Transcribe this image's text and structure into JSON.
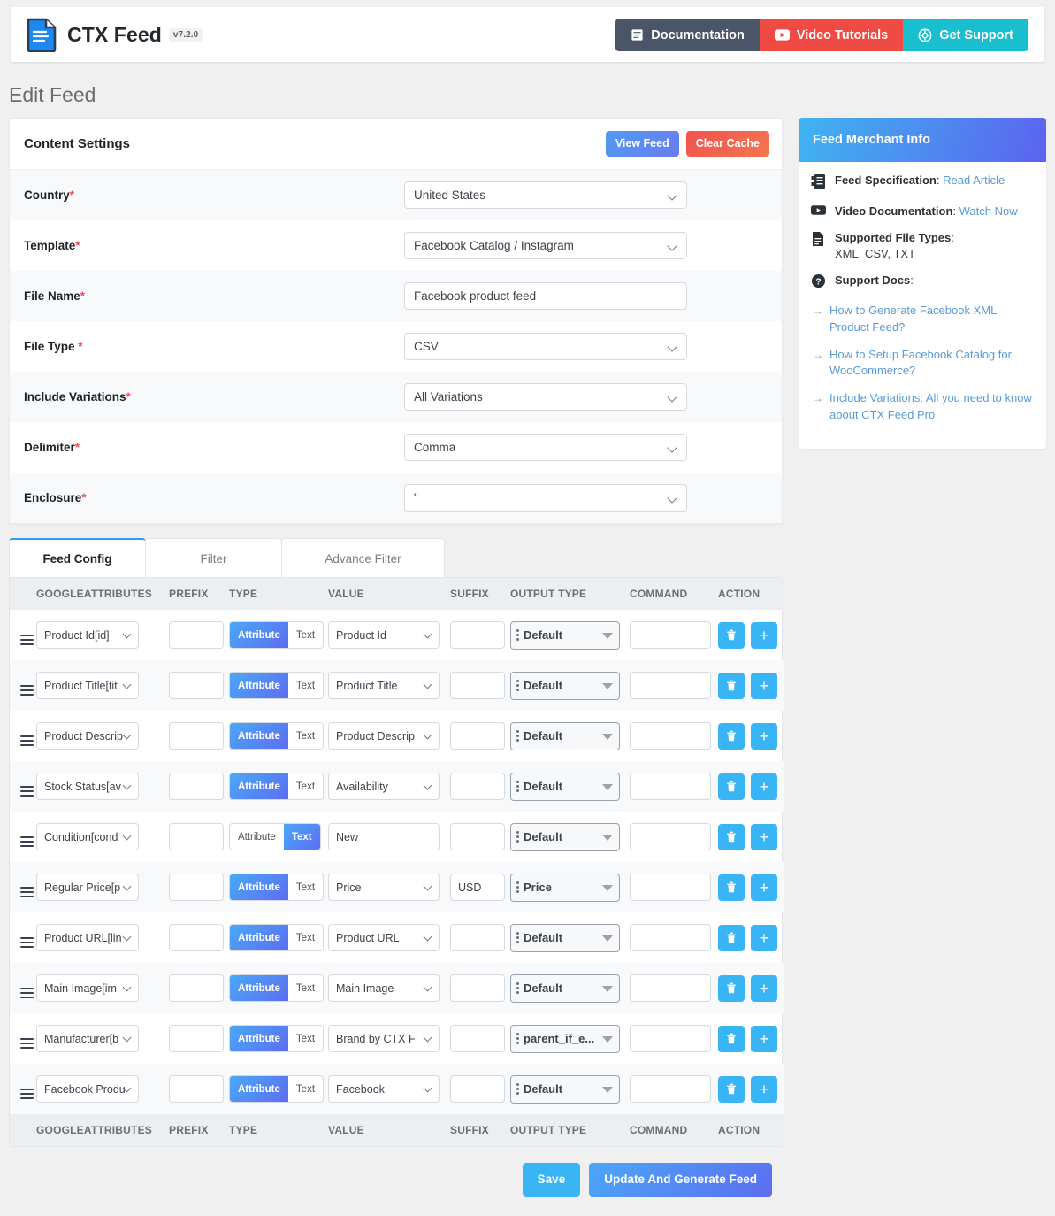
{
  "topbar": {
    "brand": "CTX Feed",
    "version": "v7.2.0",
    "logo_icon": "document-icon",
    "links": [
      {
        "label": "Documentation",
        "icon": "book-icon"
      },
      {
        "label": "Video Tutorials",
        "icon": "youtube-icon"
      },
      {
        "label": "Get Support",
        "icon": "lifebuoy-icon"
      }
    ]
  },
  "page": {
    "title": "Edit Feed"
  },
  "content_settings": {
    "heading": "Content Settings",
    "view_feed_label": "View Feed",
    "clear_cache_label": "Clear Cache",
    "fields": [
      {
        "label": "Country",
        "required": true,
        "control": "select",
        "value": "United States"
      },
      {
        "label": "Template",
        "required": true,
        "control": "select",
        "value": "Facebook Catalog / Instagram"
      },
      {
        "label": "File Name",
        "required": true,
        "control": "text",
        "value": "Facebook product feed"
      },
      {
        "label": "File Type ",
        "required": true,
        "control": "select",
        "value": "CSV"
      },
      {
        "label": "Include Variations",
        "required": true,
        "control": "select",
        "value": "All Variations"
      },
      {
        "label": "Delimiter",
        "required": true,
        "control": "select",
        "value": "Comma"
      },
      {
        "label": "Enclosure",
        "required": true,
        "control": "select",
        "value": "\""
      }
    ]
  },
  "tabs": [
    {
      "label": "Feed Config",
      "active": true
    },
    {
      "label": "Filter",
      "active": false
    },
    {
      "label": "Advance Filter",
      "active": false
    }
  ],
  "table": {
    "columns": [
      "GOOGLEATTRIBUTES",
      "PREFIX",
      "TYPE",
      "VALUE",
      "SUFFIX",
      "OUTPUT TYPE",
      "COMMAND",
      "ACTION"
    ],
    "type_options": {
      "attribute": "Attribute",
      "text": "Text"
    },
    "rows": [
      {
        "attribute": "Product Id[id]",
        "prefix": "",
        "type": "attribute",
        "value": "Product Id",
        "value_control": "select",
        "suffix": "",
        "output_type": "Default",
        "command": ""
      },
      {
        "attribute": "Product Title[tit",
        "prefix": "",
        "type": "attribute",
        "value": "Product Title",
        "value_control": "select",
        "suffix": "",
        "output_type": "Default",
        "command": ""
      },
      {
        "attribute": "Product Descrip",
        "prefix": "",
        "type": "attribute",
        "value": "Product Descrip",
        "value_control": "select",
        "suffix": "",
        "output_type": "Default",
        "command": ""
      },
      {
        "attribute": "Stock Status[av",
        "prefix": "",
        "type": "attribute",
        "value": "Availability",
        "value_control": "select",
        "suffix": "",
        "output_type": "Default",
        "command": ""
      },
      {
        "attribute": "Condition[cond",
        "prefix": "",
        "type": "text",
        "value": "New",
        "value_control": "text",
        "suffix": "",
        "output_type": "Default",
        "command": ""
      },
      {
        "attribute": "Regular Price[p",
        "prefix": "",
        "type": "attribute",
        "value": "Price",
        "value_control": "select",
        "suffix": "USD",
        "output_type": "Price",
        "command": ""
      },
      {
        "attribute": "Product URL[lin",
        "prefix": "",
        "type": "attribute",
        "value": "Product URL",
        "value_control": "select",
        "suffix": "",
        "output_type": "Default",
        "command": ""
      },
      {
        "attribute": "Main Image[im",
        "prefix": "",
        "type": "attribute",
        "value": "Main Image",
        "value_control": "select",
        "suffix": "",
        "output_type": "Default",
        "command": ""
      },
      {
        "attribute": "Manufacturer[b",
        "prefix": "",
        "type": "attribute",
        "value": "Brand by CTX F",
        "value_control": "select",
        "suffix": "",
        "output_type": "parent_if_e...",
        "command": ""
      },
      {
        "attribute": "Facebook Produ",
        "prefix": "",
        "type": "attribute",
        "value": "Facebook",
        "value_control": "select",
        "suffix": "",
        "output_type": "Default",
        "command": ""
      }
    ]
  },
  "footer": {
    "save_label": "Save",
    "update_label": "Update And Generate Feed"
  },
  "sidebar": {
    "heading": "Feed Merchant Info",
    "items": [
      {
        "icon": "spec-doc-icon",
        "label": "Feed Specification",
        "link": "Read Article",
        "sub": ""
      },
      {
        "icon": "youtube-icon",
        "label": "Video Documentation",
        "link": "Watch Now",
        "sub": ""
      },
      {
        "icon": "file-icon",
        "label": "Supported File Types",
        "link": "",
        "sub": "XML, CSV, TXT"
      },
      {
        "icon": "question-icon",
        "label": "Support Docs",
        "link": "",
        "sub": ""
      }
    ],
    "doc_links": [
      "How to Generate Facebook XML Product Feed?",
      "How to Setup Facebook Catalog for WooCommerce?",
      "Include Variations: All you need to know about CTX Feed Pro"
    ]
  },
  "colors": {
    "accent_blue": "#39b5f5",
    "doc_dark": "#4a5568",
    "video_red": "#f04a44",
    "support_teal": "#19becf",
    "required_red": "#e8505b",
    "link_blue": "#5a9bd8"
  }
}
